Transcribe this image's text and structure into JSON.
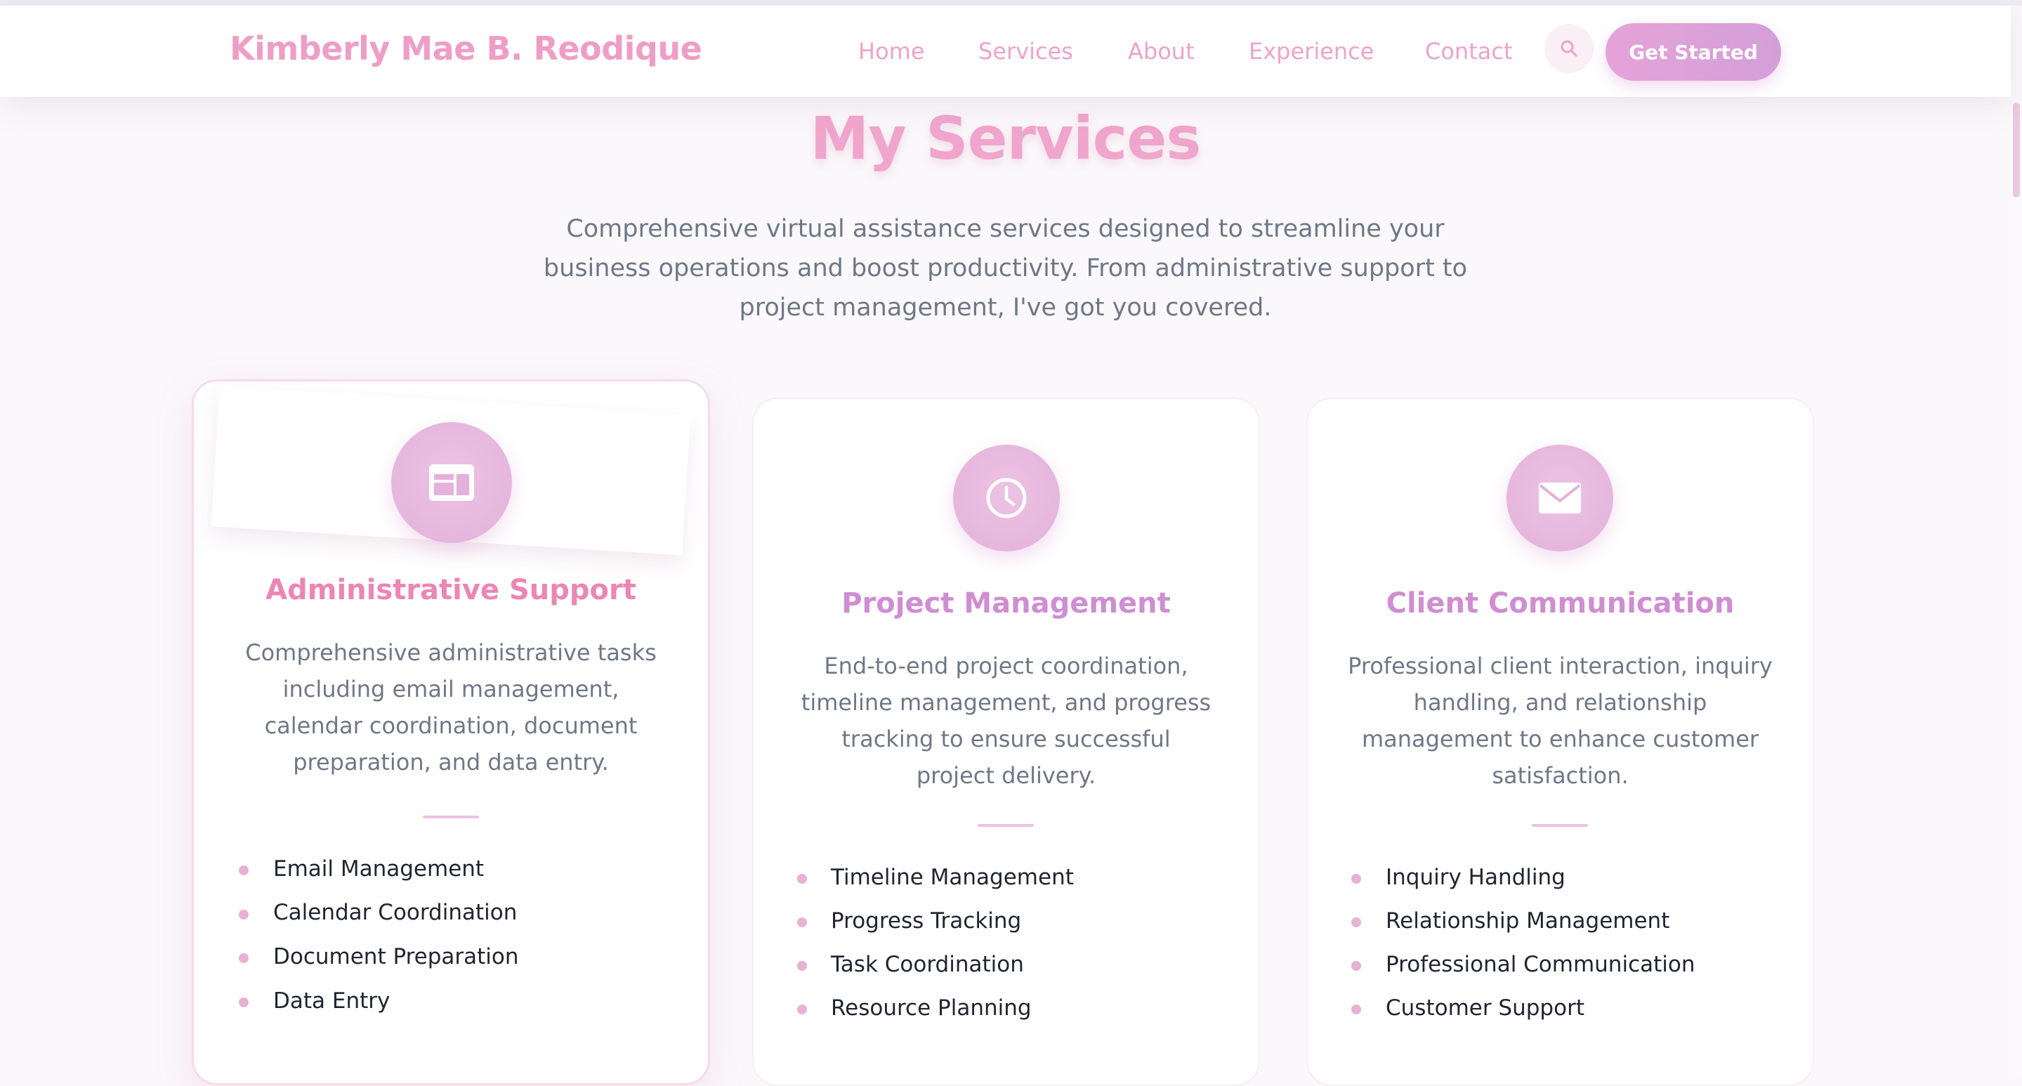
{
  "header": {
    "brand": "Kimberly Mae B. Reodique",
    "nav": [
      "Home",
      "Services",
      "About",
      "Experience",
      "Contact"
    ],
    "search_icon": "search-icon",
    "cta": "Get Started"
  },
  "section": {
    "title": "My Services",
    "description": "Comprehensive virtual assistance services designed to streamline your business operations and boost productivity. From administrative support to project management, I've got you covered."
  },
  "colors": {
    "accent_pink": "#ee9ec6",
    "accent_purple": "#d49fd9",
    "title_pink": "#eb86b5",
    "title_purple": "#cf8dd2"
  },
  "cards": [
    {
      "icon": "browser-window-icon",
      "title": "Administrative Support",
      "description": "Comprehensive administrative tasks including email management, calendar coordination, document preparation, and data entry.",
      "features": [
        "Email Management",
        "Calendar Coordination",
        "Document Preparation",
        "Data Entry"
      ]
    },
    {
      "icon": "clock-icon",
      "title": "Project Management",
      "description": "End-to-end project coordination, timeline management, and progress tracking to ensure successful project delivery.",
      "features": [
        "Timeline Management",
        "Progress Tracking",
        "Task Coordination",
        "Resource Planning"
      ]
    },
    {
      "icon": "envelope-icon",
      "title": "Client Communication",
      "description": "Professional client interaction, inquiry handling, and relationship management to enhance customer satisfaction.",
      "features": [
        "Inquiry Handling",
        "Relationship Management",
        "Professional Communication",
        "Customer Support"
      ]
    }
  ]
}
